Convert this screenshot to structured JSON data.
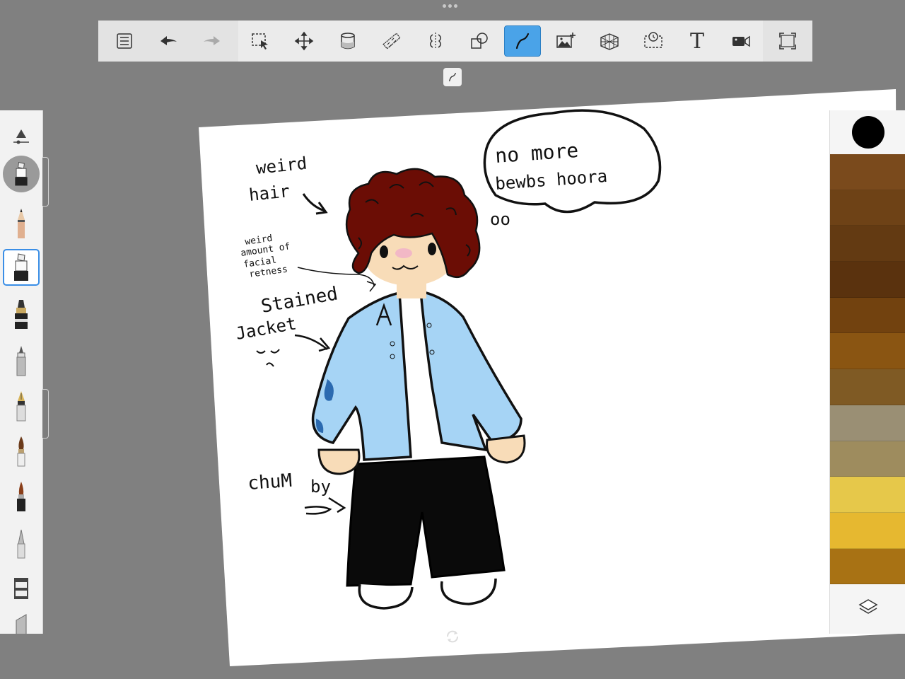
{
  "toolbar": {
    "left": [
      {
        "id": "gallery",
        "icon": "list-icon"
      },
      {
        "id": "undo",
        "icon": "undo-arrow-icon"
      },
      {
        "id": "redo",
        "icon": "redo-arrow-icon"
      }
    ],
    "tools": [
      {
        "id": "selection",
        "icon": "selection-icon"
      },
      {
        "id": "transform",
        "icon": "move-icon"
      },
      {
        "id": "fill",
        "icon": "paint-bucket-icon"
      },
      {
        "id": "ruler",
        "icon": "ruler-icon"
      },
      {
        "id": "symmetry",
        "icon": "symmetry-icon"
      },
      {
        "id": "shapes",
        "icon": "shapes-icon"
      },
      {
        "id": "stroke",
        "icon": "stroke-icon",
        "active": true
      },
      {
        "id": "import-image",
        "icon": "add-image-icon"
      },
      {
        "id": "perspective",
        "icon": "perspective-grid-icon"
      },
      {
        "id": "time-lapse",
        "icon": "timelapse-icon"
      },
      {
        "id": "text",
        "icon": "text-icon",
        "glyph": "T"
      },
      {
        "id": "record",
        "icon": "video-camera-icon"
      }
    ],
    "right": [
      {
        "id": "fullscreen",
        "icon": "fullscreen-icon"
      }
    ]
  },
  "brushes": [
    {
      "id": "pencil",
      "icon": "pencil-icon"
    },
    {
      "id": "marker",
      "icon": "marker-icon",
      "selected": true
    },
    {
      "id": "ink-pen",
      "icon": "ink-pen-icon"
    },
    {
      "id": "ballpoint",
      "icon": "ballpoint-icon"
    },
    {
      "id": "fountain-pen",
      "icon": "fountain-pen-icon"
    },
    {
      "id": "paint-brush",
      "icon": "paint-brush-icon"
    },
    {
      "id": "airbrush",
      "icon": "airbrush-brush-icon"
    },
    {
      "id": "smudge",
      "icon": "smudge-icon"
    },
    {
      "id": "eraser",
      "icon": "eraser-icon"
    },
    {
      "id": "chisel",
      "icon": "chisel-icon"
    }
  ],
  "colors": {
    "current": "#000000",
    "accent": "#4aa3e8",
    "swatches": [
      "#7a4a1c",
      "#6e4216",
      "#633a12",
      "#5a320e",
      "#72420f",
      "#8a5512",
      "#7f5a24",
      "#9a8f74",
      "#9e8c5e",
      "#e6c84a",
      "#e6b830",
      "#a87214"
    ]
  },
  "drawing": {
    "annotations": {
      "hair_line1": "weird",
      "hair_line2": "hair",
      "speech_line1": "no more",
      "speech_line2": "bewbs hoora",
      "speech_tail": "oo",
      "face_line1": "weird",
      "face_line2": "amount of",
      "face_line3": "facial",
      "face_line4": "retness",
      "jacket_line1": "Stained",
      "jacket_line2": "Jacket",
      "chunky_line1": "chuM",
      "chunky_line2": "by"
    },
    "palette": {
      "hair": "#6b0d05",
      "jacket": "#a6d4f5",
      "skin": "#f8dcb8",
      "pants": "#0a0a0a",
      "blush": "#f2b8c6"
    }
  }
}
